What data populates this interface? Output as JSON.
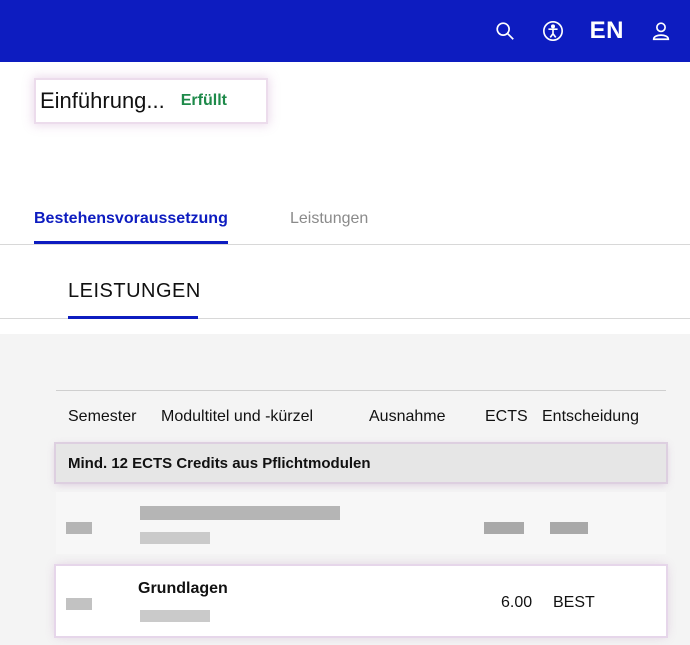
{
  "header": {
    "lang_label": "EN",
    "icons": [
      "search-icon",
      "accessibility-icon",
      "user-icon"
    ]
  },
  "status": {
    "title": "Einführung...",
    "badge": "Erfüllt",
    "badge_color": "#1e8a4a"
  },
  "tabs": [
    {
      "label": "Bestehensvoraussetzung",
      "active": true
    },
    {
      "label": "Leistungen",
      "active": false
    }
  ],
  "section": {
    "title": "LEISTUNGEN"
  },
  "table": {
    "columns": [
      "Semester",
      "Modultitel und -kürzel",
      "Ausnahme",
      "ECTS",
      "Entscheidung"
    ],
    "group_label": "Mind. 12 ECTS Credits aus Pflichtmodulen",
    "rows": [
      {
        "title": "Grundlagen",
        "ects": "6.00",
        "decision": "BEST"
      }
    ]
  },
  "colors": {
    "brand_blue": "#0d1cc0",
    "success_green": "#1e8a4a"
  }
}
